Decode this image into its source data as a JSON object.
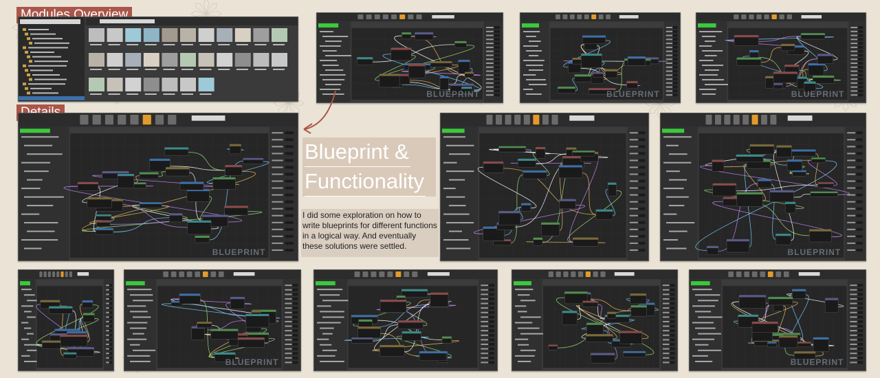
{
  "headings": {
    "modules": "Modules Overview",
    "details": "Details"
  },
  "blueprint": {
    "title_line1": "Blueprint &",
    "title_line2": "Functionality",
    "description": "I did some exploration on how to write blueprints for different functions in a logical way. And eventually these solutions were settled."
  },
  "screenshot_watermark": "BLUEPRINT",
  "screenshots": [
    {
      "id": "modules-browser",
      "kind": "browser",
      "watermark": false
    },
    {
      "id": "bp-top-1",
      "kind": "graph",
      "watermark": true,
      "seed": 3
    },
    {
      "id": "bp-top-2",
      "kind": "graph",
      "watermark": true,
      "seed": 7
    },
    {
      "id": "bp-top-3",
      "kind": "graph",
      "watermark": true,
      "seed": 11
    },
    {
      "id": "bp-details-main",
      "kind": "graph",
      "watermark": true,
      "seed": 5
    },
    {
      "id": "bp-mid-1",
      "kind": "graph",
      "watermark": false,
      "seed": 13
    },
    {
      "id": "bp-mid-2",
      "kind": "graph",
      "watermark": true,
      "seed": 17
    },
    {
      "id": "bp-bottom-1",
      "kind": "graph",
      "watermark": false,
      "seed": 19
    },
    {
      "id": "bp-bottom-2",
      "kind": "graph",
      "watermark": true,
      "seed": 23
    },
    {
      "id": "bp-bottom-3",
      "kind": "graph",
      "watermark": false,
      "seed": 29
    },
    {
      "id": "bp-bottom-4",
      "kind": "graph",
      "watermark": false,
      "seed": 31
    },
    {
      "id": "bp-bottom-5",
      "kind": "graph",
      "watermark": true,
      "seed": 37
    }
  ],
  "colors": {
    "heading_bg": "#a9574a",
    "page_bg": "#ebe4d6",
    "editor_bg": "#262626",
    "panel_bg": "#3a3a3a",
    "accent_orange": "#e39a2b",
    "accent_green": "#3cc83c"
  }
}
